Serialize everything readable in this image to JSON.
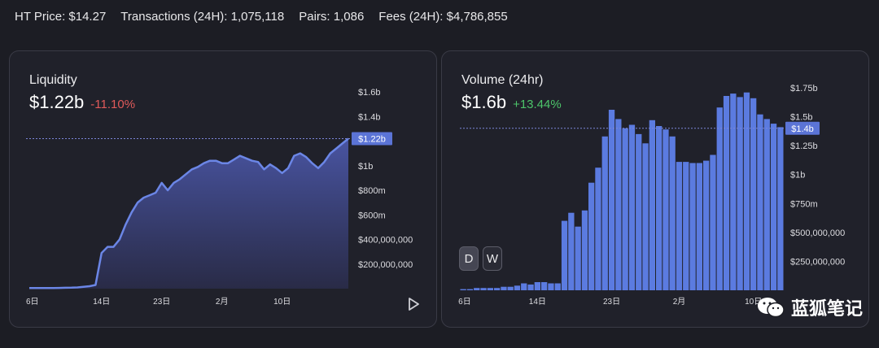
{
  "stats": {
    "ht_price": "HT Price: $14.27",
    "transactions": "Transactions (24H): 1,075,118",
    "pairs": "Pairs: 1,086",
    "fees": "Fees (24H): $4,786,855"
  },
  "liquidity": {
    "title": "Liquidity",
    "value": "$1.22b",
    "change": "-11.10%",
    "current_label": "$1.22b",
    "colors": {
      "line": "#6b86e6",
      "fill_top": "#4b57a8",
      "fill_bottom": "#2a2c4a",
      "change": "#e05a5a"
    }
  },
  "volume": {
    "title": "Volume (24hr)",
    "value": "$1.6b",
    "change": "+13.44%",
    "current_label": "$1.4b",
    "colors": {
      "bar": "#5b7be0",
      "change": "#4cc46a"
    },
    "toggle": {
      "d": "D",
      "w": "W"
    }
  },
  "watermark": {
    "text": "蓝狐笔记",
    "icon": "wechat-icon"
  },
  "chart_data": [
    {
      "type": "area",
      "title": "Liquidity",
      "x_ticks": [
        "6日",
        "14日",
        "23日",
        "2月",
        "10日"
      ],
      "y_ticks": [
        "$200,000,000",
        "$400,000,000",
        "$600m",
        "$800m",
        "$1b",
        "$1.2b",
        "$1.4b",
        "$1.6b"
      ],
      "ylim": [
        0,
        1600000000
      ],
      "current": 1220000000,
      "values": [
        0.005,
        0.005,
        0.005,
        0.005,
        0.005,
        0.006,
        0.007,
        0.008,
        0.01,
        0.015,
        0.02,
        0.03,
        0.29,
        0.34,
        0.34,
        0.4,
        0.52,
        0.62,
        0.7,
        0.74,
        0.76,
        0.78,
        0.86,
        0.8,
        0.86,
        0.89,
        0.93,
        0.97,
        0.99,
        1.02,
        1.04,
        1.04,
        1.02,
        1.02,
        1.05,
        1.08,
        1.06,
        1.04,
        1.03,
        0.97,
        1.01,
        0.98,
        0.94,
        0.98,
        1.08,
        1.1,
        1.07,
        1.02,
        0.98,
        1.03,
        1.1,
        1.14,
        1.18,
        1.22
      ]
    },
    {
      "type": "bar",
      "title": "Volume (24hr)",
      "x_ticks": [
        "6日",
        "14日",
        "23日",
        "2月",
        "10日"
      ],
      "y_ticks": [
        "$250,000,000",
        "$500,000,000",
        "$750m",
        "$1b",
        "$1.25b",
        "$1.5b",
        "$1.75b"
      ],
      "ylim": [
        0,
        1750000000
      ],
      "current": 1400000000,
      "values": [
        0.01,
        0.01,
        0.02,
        0.02,
        0.02,
        0.02,
        0.03,
        0.03,
        0.04,
        0.06,
        0.05,
        0.07,
        0.07,
        0.06,
        0.06,
        0.6,
        0.67,
        0.55,
        0.69,
        0.93,
        1.06,
        1.33,
        1.56,
        1.48,
        1.4,
        1.43,
        1.35,
        1.27,
        1.47,
        1.42,
        1.39,
        1.33,
        1.11,
        1.11,
        1.1,
        1.1,
        1.12,
        1.17,
        1.58,
        1.68,
        1.7,
        1.67,
        1.71,
        1.66,
        1.52,
        1.48,
        1.44,
        1.41
      ]
    }
  ]
}
